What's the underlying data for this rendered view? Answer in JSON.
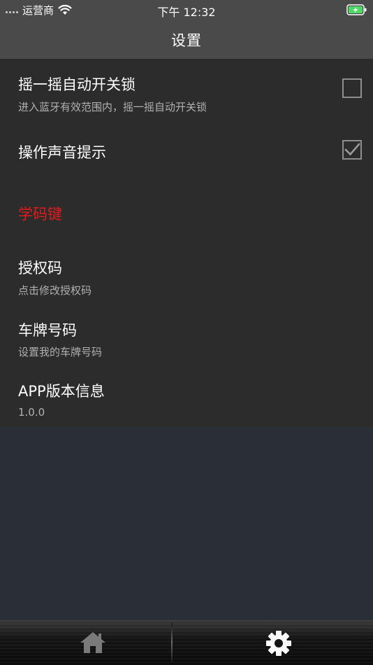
{
  "status_bar": {
    "carrier": "运营商",
    "time": "下午 12:32",
    "icons": [
      "signal-dots-icon",
      "wifi-icon",
      "battery-charging-icon"
    ]
  },
  "nav": {
    "title": "设置"
  },
  "settings": {
    "shake": {
      "title": "摇一摇自动开关锁",
      "subtitle": "进入蓝牙有效范围内，摇一摇自动开关锁",
      "checked": false
    },
    "sound": {
      "title": "操作声音提示",
      "checked": true
    },
    "learn_section": {
      "title": "学码键"
    },
    "auth_code": {
      "title": "授权码",
      "subtitle": "点击修改授权码"
    },
    "plate": {
      "title": "车牌号码",
      "subtitle": "设置我的车牌号码"
    },
    "version": {
      "title": "APP版本信息",
      "subtitle": "1.0.0"
    }
  },
  "tabs": [
    {
      "icon": "home-icon",
      "selected": false
    },
    {
      "icon": "gear-icon",
      "selected": true
    }
  ],
  "colors": {
    "header_bg": "#4a4a4a",
    "content_bg": "#2c2c2c",
    "page_bg": "#2a2e37",
    "section_accent": "#e21a1a",
    "battery_green": "#4cd964"
  }
}
